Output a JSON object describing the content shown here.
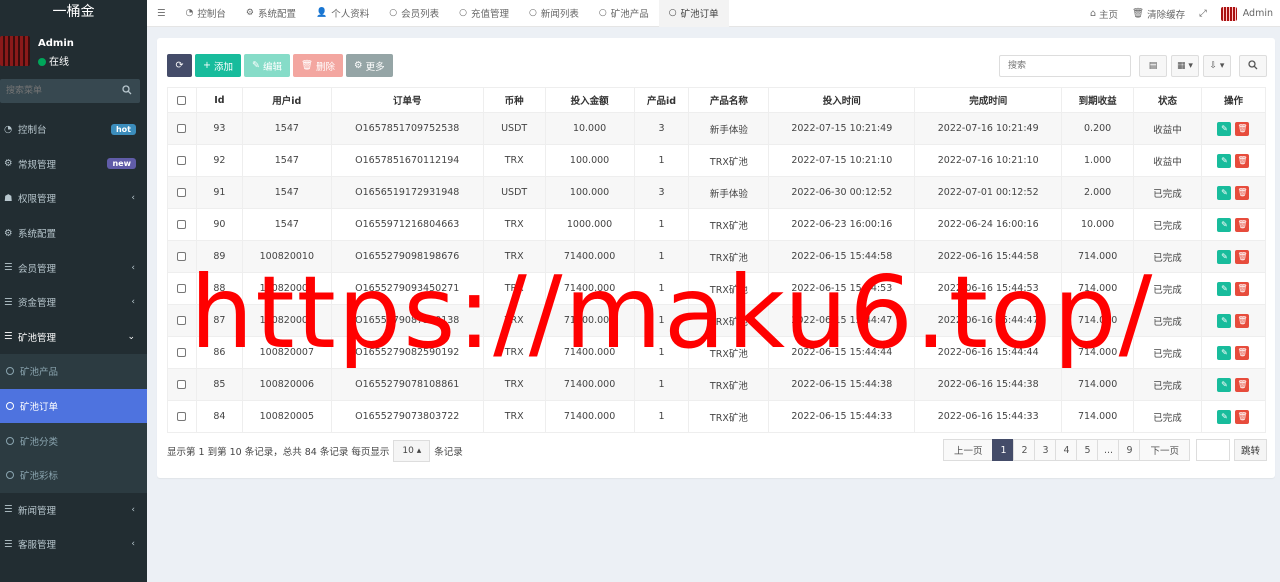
{
  "brand": "一桶金",
  "user": {
    "name": "Admin",
    "status": "在线"
  },
  "sidebar": {
    "search_placeholder": "搜索菜单",
    "items": [
      {
        "label": "控制台",
        "badge": "hot"
      },
      {
        "label": "常规管理",
        "badge": "new"
      },
      {
        "label": "权限管理"
      },
      {
        "label": "系统配置"
      },
      {
        "label": "会员管理"
      },
      {
        "label": "资金管理"
      },
      {
        "label": "矿池管理"
      }
    ],
    "submenu": [
      {
        "label": "矿池产品"
      },
      {
        "label": "矿池订单"
      },
      {
        "label": "矿池分类"
      },
      {
        "label": "矿池彩标"
      }
    ],
    "after_items": [
      {
        "label": "新闻管理"
      },
      {
        "label": "客服管理"
      }
    ]
  },
  "tabs": [
    "控制台",
    "系统配置",
    "个人资料",
    "会员列表",
    "充值管理",
    "新闻列表",
    "矿池产品",
    "矿池订单"
  ],
  "top_right": {
    "home": "主页",
    "clear_cache": "清除缓存",
    "user": "Admin"
  },
  "toolbar": {
    "add": "添加",
    "edit": "编辑",
    "delete": "删除",
    "more": "更多",
    "search_placeholder": "搜索"
  },
  "table": {
    "headers": [
      "Id",
      "用户id",
      "订单号",
      "币种",
      "投入金额",
      "产品id",
      "产品名称",
      "投入时间",
      "完成时间",
      "到期收益",
      "状态",
      "操作"
    ],
    "rows": [
      [
        "93",
        "1547",
        "O1657851709752538",
        "USDT",
        "10.000",
        "3",
        "新手体验",
        "2022-07-15 10:21:49",
        "2022-07-16 10:21:49",
        "0.200",
        "收益中"
      ],
      [
        "92",
        "1547",
        "O1657851670112194",
        "TRX",
        "100.000",
        "1",
        "TRX矿池",
        "2022-07-15 10:21:10",
        "2022-07-16 10:21:10",
        "1.000",
        "收益中"
      ],
      [
        "91",
        "1547",
        "O1656519172931948",
        "USDT",
        "100.000",
        "3",
        "新手体验",
        "2022-06-30 00:12:52",
        "2022-07-01 00:12:52",
        "2.000",
        "已完成"
      ],
      [
        "90",
        "1547",
        "O1655971216804663",
        "TRX",
        "1000.000",
        "1",
        "TRX矿池",
        "2022-06-23 16:00:16",
        "2022-06-24 16:00:16",
        "10.000",
        "已完成"
      ],
      [
        "89",
        "100820010",
        "O1655279098198676",
        "TRX",
        "71400.000",
        "1",
        "TRX矿池",
        "2022-06-15 15:44:58",
        "2022-06-16 15:44:58",
        "714.000",
        "已完成"
      ],
      [
        "88",
        "100820009",
        "O1655279093450271",
        "TRX",
        "71400.000",
        "1",
        "TRX矿池",
        "2022-06-15 15:44:53",
        "2022-06-16 15:44:53",
        "714.000",
        "已完成"
      ],
      [
        "87",
        "100820008",
        "O1655279087500138",
        "TRX",
        "71400.000",
        "1",
        "TRX矿池",
        "2022-06-15 15:44:47",
        "2022-06-16 15:44:47",
        "714.000",
        "已完成"
      ],
      [
        "86",
        "100820007",
        "O1655279082590192",
        "TRX",
        "71400.000",
        "1",
        "TRX矿池",
        "2022-06-15 15:44:44",
        "2022-06-16 15:44:44",
        "714.000",
        "已完成"
      ],
      [
        "85",
        "100820006",
        "O1655279078108861",
        "TRX",
        "71400.000",
        "1",
        "TRX矿池",
        "2022-06-15 15:44:38",
        "2022-06-16 15:44:38",
        "714.000",
        "已完成"
      ],
      [
        "84",
        "100820005",
        "O1655279073803722",
        "TRX",
        "71400.000",
        "1",
        "TRX矿池",
        "2022-06-15 15:44:33",
        "2022-06-16 15:44:33",
        "714.000",
        "已完成"
      ]
    ]
  },
  "pager": {
    "info_prefix": "显示第 1 到第 10 条记录，总共 84 条记录 每页显示",
    "page_size": "10",
    "info_suffix": "条记录",
    "prev": "上一页",
    "pages": [
      "1",
      "2",
      "3",
      "4",
      "5",
      "...",
      "9"
    ],
    "next": "下一页",
    "jump": "跳转"
  },
  "watermark": "https://maku6.top/",
  "colors": {
    "sidebar_bg": "#222d32",
    "active_item": "#4e73df",
    "success": "#18bc9c",
    "danger": "#e74c3c",
    "watermark": "#ff0000"
  }
}
